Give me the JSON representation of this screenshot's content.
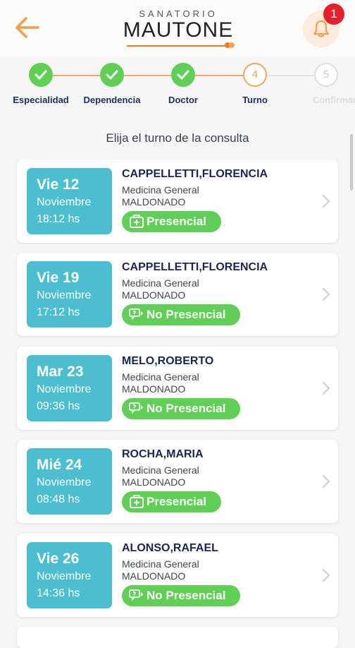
{
  "header": {
    "logo_top": "SANATORIO",
    "logo_main": "MAUTONE",
    "notifications_count": "1",
    "accent_color": "#ef7d1a"
  },
  "stepper": {
    "steps": [
      {
        "number": "1",
        "label": "Especialidad",
        "state": "done"
      },
      {
        "number": "2",
        "label": "Dependencia",
        "state": "done"
      },
      {
        "number": "3",
        "label": "Doctor",
        "state": "done"
      },
      {
        "number": "4",
        "label": "Turno",
        "state": "current"
      },
      {
        "number": "5",
        "label": "Confirmar",
        "state": "future"
      }
    ]
  },
  "prompt": "Elija el turno de la consulta",
  "appointments": [
    {
      "day": "Vie 12",
      "month": "Noviembre",
      "time": "18:12 hs",
      "doctor": "CAPPELLETTI,FLORENCIA",
      "specialty": "Medicina General",
      "location": "MALDONADO",
      "mode": "Presencial",
      "mode_icon": "hospital-icon"
    },
    {
      "day": "Vie 19",
      "month": "Noviembre",
      "time": "17:12 hs",
      "doctor": "CAPPELLETTI,FLORENCIA",
      "specialty": "Medicina General",
      "location": "MALDONADO",
      "mode": "No Presencial",
      "mode_icon": "phone-chat-icon"
    },
    {
      "day": "Mar 23",
      "month": "Noviembre",
      "time": "09:36 hs",
      "doctor": "MELO,ROBERTO",
      "specialty": "Medicina General",
      "location": "MALDONADO",
      "mode": "No Presencial",
      "mode_icon": "phone-chat-icon"
    },
    {
      "day": "Mié 24",
      "month": "Noviembre",
      "time": "08:48 hs",
      "doctor": "ROCHA,MARIA",
      "specialty": "Medicina General",
      "location": "MALDONADO",
      "mode": "Presencial",
      "mode_icon": "hospital-icon"
    },
    {
      "day": "Vie 26",
      "month": "Noviembre",
      "time": "14:36 hs",
      "doctor": "ALONSO,RAFAEL",
      "specialty": "Medicina General",
      "location": "MALDONADO",
      "mode": "No Presencial",
      "mode_icon": "phone-chat-icon"
    }
  ],
  "colors": {
    "date_box": "#4bbfcf",
    "pill_green": "#5fcf55",
    "step_done": "#5fcf55",
    "step_current": "#f0a560",
    "name_navy": "#1b2555",
    "badge_red": "#e81e2a"
  }
}
